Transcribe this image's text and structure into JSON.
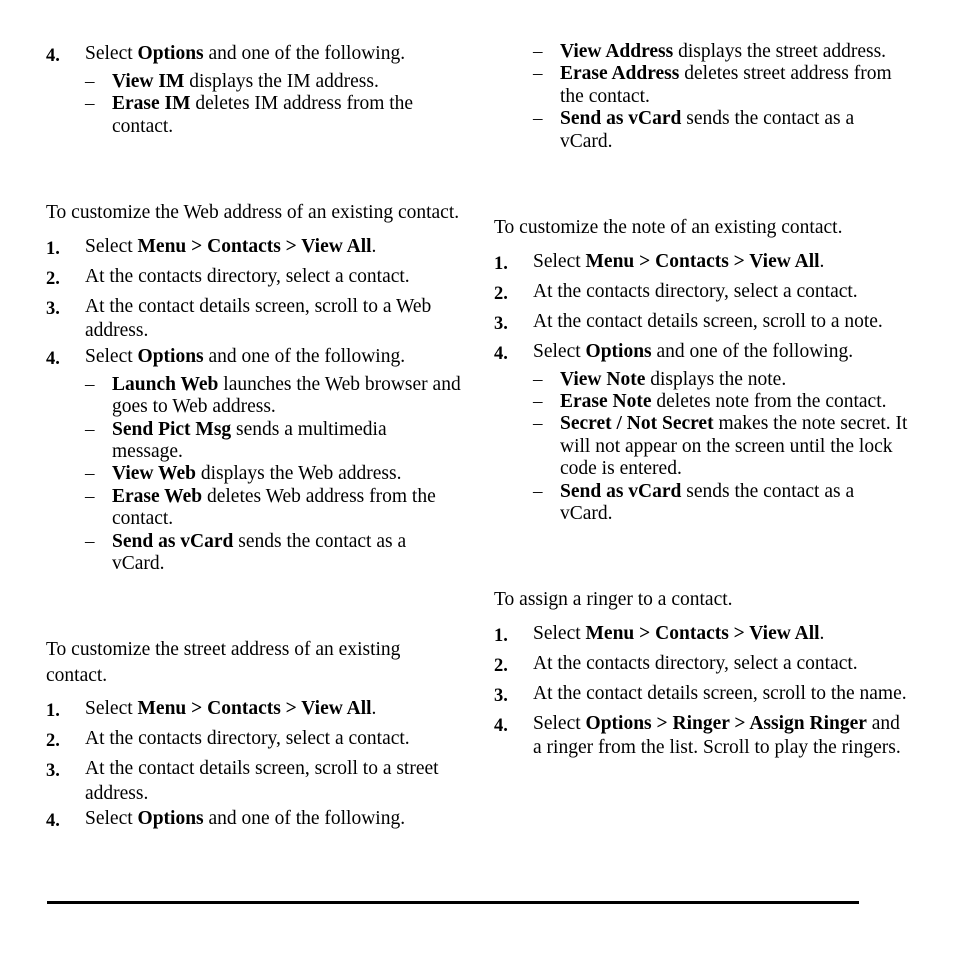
{
  "page": {
    "background_color": "#ffffff",
    "text_color": "#000000",
    "rule_color": "#000000"
  },
  "left_column": {
    "im_options": {
      "step": {
        "num": "4.",
        "text_before": "Select ",
        "bold": "Options",
        "text_after": " and one of the following."
      },
      "items": [
        {
          "dash": "–",
          "bold": "View IM",
          "rest": " displays the IM address."
        },
        {
          "dash": "–",
          "bold": "Erase IM",
          "rest": " deletes IM address from the contact."
        }
      ]
    },
    "web_section": {
      "intro": "To customize the Web address of an existing contact.",
      "steps": [
        {
          "num": "1.",
          "prefix": "Select ",
          "bold": "Menu > Contacts > View All",
          "suffix": "."
        },
        {
          "num": "2.",
          "prefix": "At the contacts directory, select a contact.",
          "bold": "",
          "suffix": ""
        },
        {
          "num": "3.",
          "prefix": "At the contact details screen, scroll to a Web address.",
          "bold": "",
          "suffix": ""
        },
        {
          "num": "4.",
          "prefix": "Select ",
          "bold": "Options",
          "suffix": " and one of the following."
        }
      ],
      "items": [
        {
          "dash": "–",
          "bold": "Launch Web",
          "rest": " launches the Web browser and goes to Web address."
        },
        {
          "dash": "–",
          "bold": "Send Pict Msg",
          "rest": " sends a multimedia message."
        },
        {
          "dash": "–",
          "bold": "View Web",
          "rest": " displays the Web address."
        },
        {
          "dash": "–",
          "bold": "Erase Web",
          "rest": " deletes Web address from the contact."
        },
        {
          "dash": "–",
          "bold": "Send as vCard",
          "rest": " sends the contact as a vCard."
        }
      ]
    },
    "street_section": {
      "intro": "To customize the street address of an existing contact.",
      "steps": [
        {
          "num": "1.",
          "prefix": "Select ",
          "bold": "Menu > Contacts > View All",
          "suffix": "."
        },
        {
          "num": "2.",
          "prefix": "At the contacts directory, select a contact.",
          "bold": "",
          "suffix": ""
        },
        {
          "num": "3.",
          "prefix": "At the contact details screen, scroll to a street address.",
          "bold": "",
          "suffix": ""
        },
        {
          "num": "4.",
          "prefix": "Select ",
          "bold": "Options",
          "suffix": " and one of the following."
        }
      ]
    }
  },
  "right_column": {
    "address_options": {
      "items": [
        {
          "dash": "–",
          "bold": "View Address",
          "rest": " displays the street address."
        },
        {
          "dash": "–",
          "bold": "Erase Address",
          "rest": " deletes street address from the contact."
        },
        {
          "dash": "–",
          "bold": "Send as vCard",
          "rest": " sends the contact as a vCard."
        }
      ]
    },
    "note_section": {
      "intro": "To customize the note of an existing contact.",
      "steps": [
        {
          "num": "1.",
          "prefix": "Select ",
          "bold": "Menu  > Contacts  > View All",
          "suffix": "."
        },
        {
          "num": "2.",
          "prefix": "At the contacts directory, select a contact.",
          "bold": "",
          "suffix": ""
        },
        {
          "num": "3.",
          "prefix": "At the contact details screen, scroll to a note.",
          "bold": "",
          "suffix": ""
        },
        {
          "num": "4.",
          "prefix": "Select ",
          "bold": "Options",
          "suffix": " and one of the following."
        }
      ],
      "items": [
        {
          "dash": "–",
          "bold": "View Note",
          "rest": " displays the note."
        },
        {
          "dash": "–",
          "bold": "Erase Note",
          "rest": " deletes note from the contact."
        },
        {
          "dash": "–",
          "bold": "Secret / Not Secret",
          "rest": " makes the note secret. It will not appear on the screen until the lock code is entered."
        },
        {
          "dash": "–",
          "bold": "Send as vCard",
          "rest": " sends the contact as a vCard."
        }
      ]
    },
    "ringer_section": {
      "intro": "To assign a ringer to a contact.",
      "steps": [
        {
          "num": "1.",
          "prefix": "Select ",
          "bold": "Menu  > Contacts  > View All",
          "suffix": "."
        },
        {
          "num": "2.",
          "prefix": "At the contacts directory, select a contact.",
          "bold": "",
          "suffix": ""
        },
        {
          "num": "3.",
          "prefix": "At the contact details screen, scroll to the name.",
          "bold": "",
          "suffix": ""
        },
        {
          "num": "4.",
          "prefix": "Select ",
          "bold": "Options  > Ringer > Assign Ringer",
          "suffix": " and a ringer from the list. Scroll to play the ringers."
        }
      ]
    }
  }
}
